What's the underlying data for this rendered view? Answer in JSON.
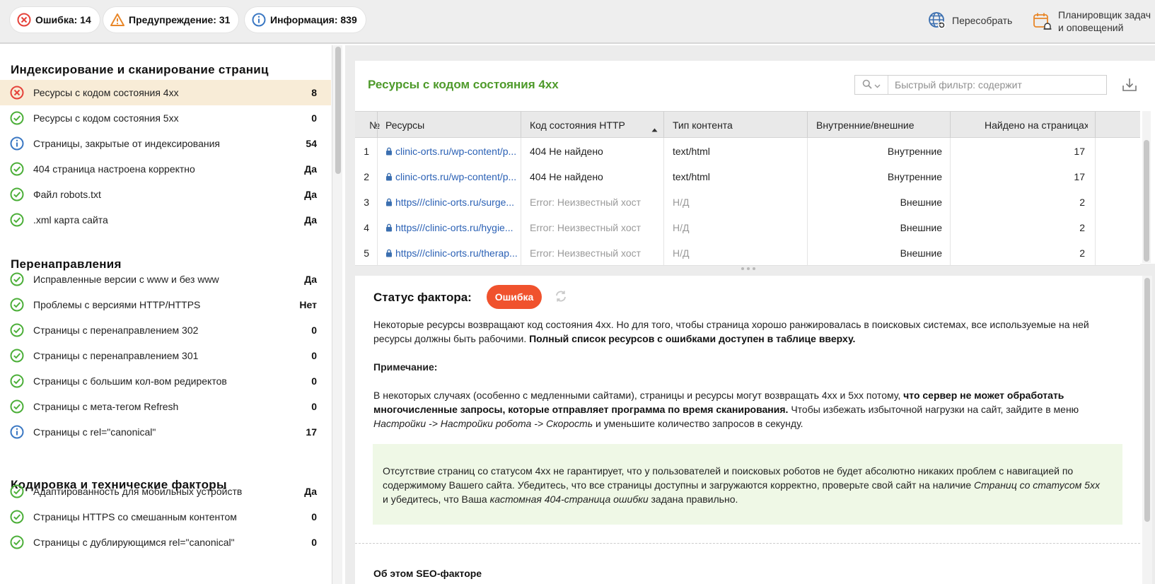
{
  "toolbar": {
    "error_label": "Ошибка: 14",
    "warning_label": "Предупреждение: 31",
    "info_label": "Информация: 839",
    "rebuild_label": "Пересобрать",
    "scheduler_label": "Планировщик задач\nи оповещений"
  },
  "sidebar": {
    "sections": [
      {
        "title": "Индексирование и сканирование страниц",
        "items": [
          {
            "label": "Ресурсы с кодом состояния 4xx",
            "value": "8",
            "status": "error",
            "selected": true
          },
          {
            "label": "Ресурсы с кодом состояния 5xx",
            "value": "0",
            "status": "ok"
          },
          {
            "label": "Страницы, закрытые от индексирования",
            "value": "54",
            "status": "info"
          },
          {
            "label": "404 страница настроена корректно",
            "value": "Да",
            "status": "ok"
          },
          {
            "label": "Файл robots.txt",
            "value": "Да",
            "status": "ok"
          },
          {
            "label": ".xml карта сайта",
            "value": "Да",
            "status": "ok"
          }
        ]
      },
      {
        "title": "Перенаправления",
        "items": [
          {
            "label": "Исправленные версии с www и без www",
            "value": "Да",
            "status": "ok"
          },
          {
            "label": "Проблемы с версиями HTTP/HTTPS",
            "value": "Нет",
            "status": "ok"
          },
          {
            "label": "Страницы с перенаправлением 302",
            "value": "0",
            "status": "ok"
          },
          {
            "label": "Страницы с перенаправлением 301",
            "value": "0",
            "status": "ok"
          },
          {
            "label": "Страницы с большим кол-вом редиректов",
            "value": "0",
            "status": "ok"
          },
          {
            "label": "Страницы с мета-тегом Refresh",
            "value": "0",
            "status": "ok"
          },
          {
            "label": "Страницы с rel=\"canonical\"",
            "value": "17",
            "status": "info"
          }
        ]
      },
      {
        "title": "Кодировка и технические факторы",
        "items": [
          {
            "label": "Адаптированность для мобильных устройств",
            "value": "Да",
            "status": "ok"
          },
          {
            "label": "Страницы HTTPS со смешанным контентом",
            "value": "0",
            "status": "ok"
          },
          {
            "label": "Страницы с дублирующимся rel=\"canonical\"",
            "value": "0",
            "status": "ok"
          }
        ]
      }
    ]
  },
  "panel": {
    "title": "Ресурсы с кодом состояния 4xx",
    "filter_placeholder": "Быстрый фильтр: содержит"
  },
  "table": {
    "columns": [
      "№",
      "Ресурсы",
      "Код состояния HTTP",
      "Тип контента",
      "Внутренние/внешние",
      "Найдено на страницах"
    ],
    "rows": [
      {
        "n": "1",
        "resource": "clinic-orts.ru/wp-content/p...",
        "code": "404 Не найдено",
        "type": "text/html",
        "scope": "Внутренние",
        "found": "17",
        "error": false
      },
      {
        "n": "2",
        "resource": "clinic-orts.ru/wp-content/p...",
        "code": "404 Не найдено",
        "type": "text/html",
        "scope": "Внутренние",
        "found": "17",
        "error": false
      },
      {
        "n": "3",
        "resource": "https///clinic-orts.ru/surge...",
        "code": "Error: Неизвестный хост",
        "type": "Н/Д",
        "scope": "Внешние",
        "found": "2",
        "error": true
      },
      {
        "n": "4",
        "resource": "https///clinic-orts.ru/hygie...",
        "code": "Error: Неизвестный хост",
        "type": "Н/Д",
        "scope": "Внешние",
        "found": "2",
        "error": true
      },
      {
        "n": "5",
        "resource": "https///clinic-orts.ru/therap...",
        "code": "Error: Неизвестный хост",
        "type": "Н/Д",
        "scope": "Внешние",
        "found": "2",
        "error": true
      }
    ]
  },
  "details": {
    "status_label": "Статус фактора:",
    "status_value": "Ошибка",
    "p1_text": "Некоторые ресурсы возвращают код состояния 4xx. Но для того, чтобы страница хорошо ранжировалась в поисковых системах, все используемые на ней ресурсы должны быть рабочими. ",
    "p1_bold": "Полный список ресурсов с ошибками доступен в таблице вверху.",
    "note_heading": "Примечание:",
    "p2_text1": "В некоторых случаях (особенно с медленными сайтами), страницы и ресурсы могут возвращать 4xx и 5xx потому, ",
    "p2_bold": "что сервер не может обработать многочисленные запросы, которые отправляет программа по время сканирования.",
    "p2_text2": " Чтобы избежать избыточной нагрузки на сайт, зайдите в меню ",
    "p2_italic": "Настройки -> Настройки робота -> Скорость",
    "p2_text3": " и уменьшите количество запросов в секунду.",
    "tip_text1": "Отсутствие страниц со статусом 4xx не гарантирует, что у пользователей и поисковых роботов не будет абсолютно никаких проблем с навигацией по содержимому Вашего сайта. Убедитесь, что все страницы доступны и загружаются корректно, проверьте свой сайт на наличие ",
    "tip_italic1": "Страниц со статусом 5xx",
    "tip_text2": " и убедитесь, что Ваша ",
    "tip_italic2": "кастомная 404-страница ошибки",
    "tip_text3": " задана правильно.",
    "about_heading": "Об этом SEO-факторе"
  },
  "colors": {
    "error": "#e5423a",
    "warning": "#e8872a",
    "info": "#3b78c3",
    "ok": "#4caf39",
    "accent_green": "#4e9a2a",
    "selected_row": "#f8ecd7"
  }
}
